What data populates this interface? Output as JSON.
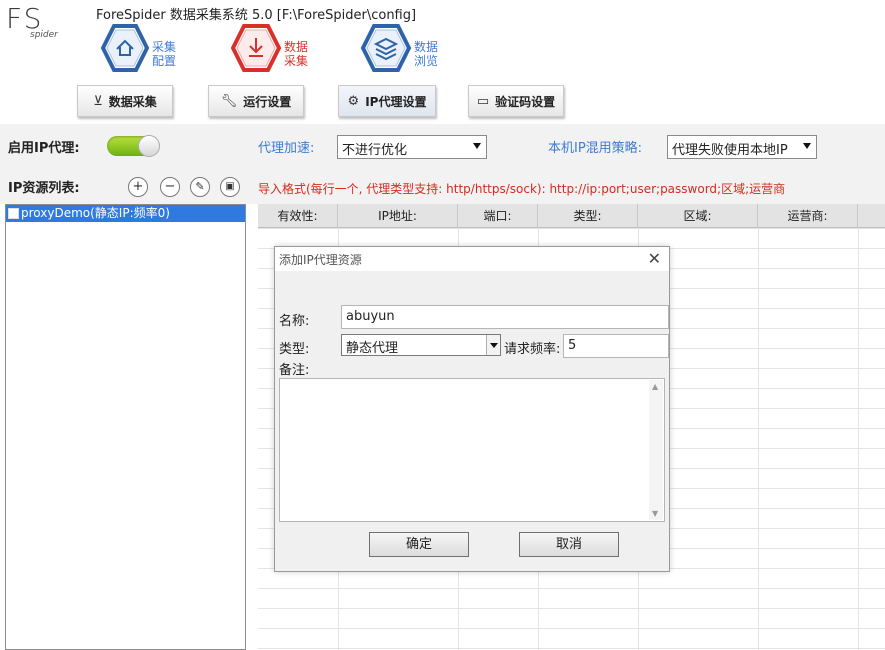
{
  "app": {
    "logo_text": "FS",
    "logo_sub": "spider",
    "title": "ForeSpider 数据采集系统  5.0  [F:\\ForeSpider\\config]"
  },
  "nav": {
    "collect_config": "采集\n配置",
    "data_collect": "数据\n采集",
    "data_browse": "数据\n浏览"
  },
  "tabs": {
    "data_collect": "数据采集",
    "run_settings": "运行设置",
    "ip_proxy": "IP代理设置",
    "captcha": "验证码设置"
  },
  "settings": {
    "enable_label": "启用IP代理:",
    "enabled": true,
    "accel_label": "代理加速:",
    "accel_value": "不进行优化",
    "strategy_label": "本机IP混用策略:",
    "strategy_value": "代理失败使用本地IP",
    "list_label": "IP资源列表:",
    "import_hint": "导入格式(每行一个, 代理类型支持: http/https/sock):     http://ip:port;user;password;区域;运营商"
  },
  "list": {
    "items": [
      {
        "label": "proxyDemo(静态IP:频率0)"
      }
    ]
  },
  "grid": {
    "columns": [
      "有效性:",
      "IP地址:",
      "端口:",
      "类型:",
      "区域:",
      "运营商:"
    ]
  },
  "dialog": {
    "title": "添加IP代理资源",
    "name_label": "名称:",
    "name_value": "abuyun",
    "type_label": "类型:",
    "type_value": "静态代理",
    "freq_label": "请求频率:",
    "freq_value": "5",
    "note_label": "备注:",
    "note_value": "",
    "ok_label": "确定",
    "cancel_label": "取消"
  },
  "colors": {
    "accent_blue": "#3d7bd6",
    "active_red": "#d9302a",
    "hint_red": "#d52b1e",
    "selection": "#2f7ae0",
    "toggle_green": "#7cc11a"
  }
}
